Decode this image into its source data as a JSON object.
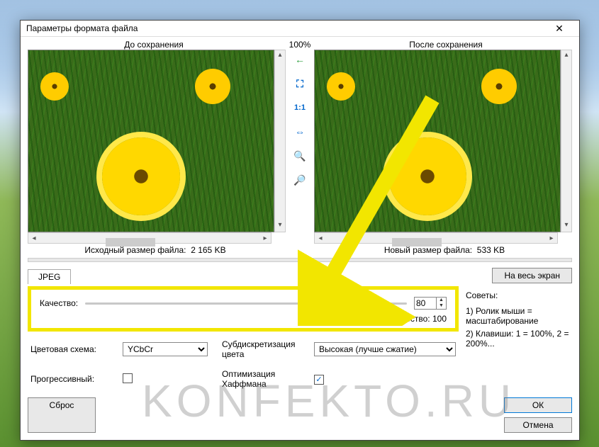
{
  "window": {
    "title": "Параметры формата файла"
  },
  "preview": {
    "before_label": "До сохранения",
    "after_label": "После сохранения",
    "zoom": "100%",
    "orig_size_label": "Исходный размер файла:",
    "orig_size_value": "2 165 KB",
    "new_size_label": "Новый размер файла:",
    "new_size_value": "533 KB"
  },
  "toolbar": {
    "fullscreen": "На весь экран",
    "tools": [
      "back-arrow",
      "fit-screen",
      "1:1",
      "fit-width",
      "zoom-in",
      "zoom-out"
    ]
  },
  "tabs": {
    "jpeg": "JPEG"
  },
  "quality": {
    "label": "Качество:",
    "value": "80",
    "slider_pos_pct": 78,
    "orig_label": "Исходное качество:",
    "orig_value": "100"
  },
  "tips": {
    "header": "Советы:",
    "line1": "1) Ролик мыши = масштабирование",
    "line2": "2) Клавиши: 1 = 100%, 2 = 200%..."
  },
  "options": {
    "color_scheme_label": "Цветовая схема:",
    "color_scheme_value": "YCbCr",
    "subsampling_label": "Субдискретизация цвета",
    "subsampling_value": "Высокая (лучше сжатие)",
    "progressive_label": "Прогрессивный:",
    "progressive_checked": false,
    "huffman_label": "Оптимизация Хаффмана",
    "huffman_checked": true
  },
  "buttons": {
    "reset": "Сброс",
    "ok": "ОК",
    "cancel": "Отмена"
  },
  "watermark": "KONFEKTO.RU"
}
